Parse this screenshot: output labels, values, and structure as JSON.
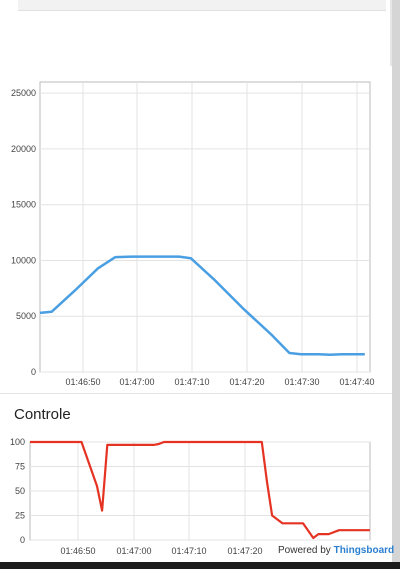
{
  "chart_data": [
    {
      "type": "line",
      "title": "",
      "xlabel": "",
      "ylabel": "",
      "ylim": [
        0,
        26000
      ],
      "xlim_seconds": [
        0,
        52
      ],
      "y_ticks": [
        "0",
        "5000",
        "10000",
        "15000",
        "20000",
        "25000"
      ],
      "x_ticks": [
        "01:46:50",
        "01:47:00",
        "01:47:10",
        "01:47:20",
        "01:47:30",
        "01:47:40"
      ],
      "grid": true,
      "series": [
        {
          "name": "",
          "color": "#4a9fe3",
          "points": [
            [
              0,
              5300
            ],
            [
              2,
              5400
            ],
            [
              6,
              7300
            ],
            [
              10,
              9300
            ],
            [
              13,
              10300
            ],
            [
              16,
              10350
            ],
            [
              20,
              10350
            ],
            [
              24,
              10350
            ],
            [
              26,
              10200
            ],
            [
              30,
              8300
            ],
            [
              35,
              5700
            ],
            [
              40,
              3300
            ],
            [
              43,
              1700
            ],
            [
              45,
              1600
            ],
            [
              48,
              1600
            ],
            [
              50,
              1550
            ],
            [
              52,
              1600
            ],
            [
              56,
              1600
            ]
          ]
        }
      ]
    },
    {
      "type": "line",
      "title": "Controle",
      "xlabel": "",
      "ylabel": "",
      "ylim": [
        0,
        100
      ],
      "y_ticks": [
        "0",
        "25",
        "50",
        "75",
        "100"
      ],
      "x_ticks": [
        "01:46:50",
        "01:47:00",
        "01:47:10",
        "01:47:20"
      ],
      "grid": true,
      "series": [
        {
          "name": "",
          "color": "#e53323",
          "points": [
            [
              0,
              100
            ],
            [
              10,
              100
            ],
            [
              13,
              55
            ],
            [
              14,
              30
            ],
            [
              15,
              97
            ],
            [
              20,
              97
            ],
            [
              24,
              97
            ],
            [
              25,
              98
            ],
            [
              26,
              100
            ],
            [
              30,
              100
            ],
            [
              40,
              100
            ],
            [
              45,
              100
            ],
            [
              46,
              60
            ],
            [
              47,
              25
            ],
            [
              49,
              17
            ],
            [
              53,
              17
            ],
            [
              55,
              2
            ],
            [
              56,
              6
            ],
            [
              58,
              6
            ],
            [
              60,
              10
            ],
            [
              63,
              10
            ],
            [
              66,
              10
            ]
          ]
        }
      ]
    }
  ],
  "section": {
    "title": "Controle"
  },
  "footer": {
    "prefix": "Powered by ",
    "brand": "Thingsboard"
  }
}
